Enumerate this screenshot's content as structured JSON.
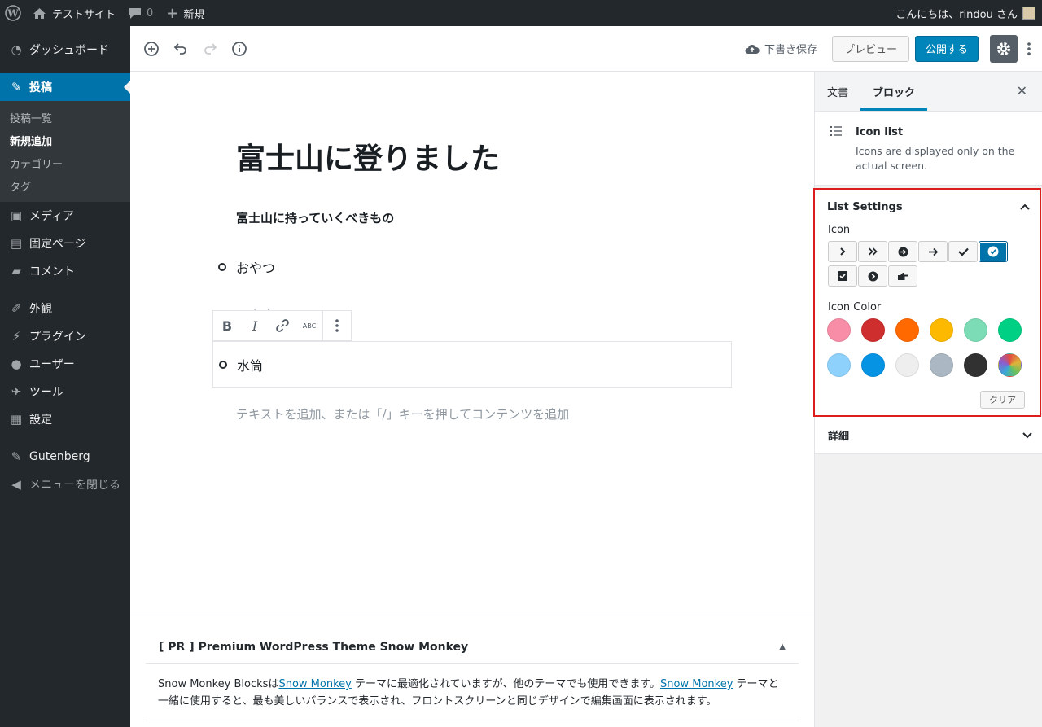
{
  "adminbar": {
    "site_name": "テストサイト",
    "comments_count": "0",
    "new_label": "新規",
    "greeting": "こんにちは、rindou さん"
  },
  "menu": {
    "dashboard": "ダッシュボード",
    "posts": "投稿",
    "posts_sub": [
      "投稿一覧",
      "新規追加",
      "カテゴリー",
      "タグ"
    ],
    "media": "メディア",
    "pages": "固定ページ",
    "comments": "コメント",
    "appearance": "外観",
    "plugins": "プラグイン",
    "users": "ユーザー",
    "tools": "ツール",
    "settings": "設定",
    "gutenberg": "Gutenberg",
    "collapse": "メニューを閉じる"
  },
  "header": {
    "save_draft": "下書き保存",
    "preview": "プレビュー",
    "publish": "公開する"
  },
  "post": {
    "title": "富士山に登りました",
    "subheading": "富士山に持っていくべきもの",
    "list_items": [
      "おやつ",
      "水筒"
    ],
    "hidden_item": "お弁当",
    "placeholder": "テキストを追加、または「/」キーを押してコンテンツを追加"
  },
  "block_toolbar": {
    "bold": "B",
    "italic": "I",
    "strike": "ABC"
  },
  "sidebar": {
    "tab_document": "文書",
    "tab_block": "ブロック",
    "block_name": "Icon list",
    "block_desc": "Icons are displayed only on the actual screen.",
    "list_settings": "List Settings",
    "icon_label": "Icon",
    "icons": [
      "chevron-right",
      "double-chevron-right",
      "circle-arrow-right",
      "arrow-right",
      "check",
      "check-circle",
      "check-square",
      "circle-chevron-right",
      "hand-point-right"
    ],
    "selected_icon_index": 5,
    "icon_color_label": "Icon Color",
    "colors": [
      "#f78da7",
      "#cf2e2e",
      "#ff6900",
      "#fcb900",
      "#7bdcb5",
      "#00d084",
      "#8ed1fc",
      "#0693e3",
      "#eeeeee",
      "#abb8c3",
      "#313131",
      "gradient"
    ],
    "clear": "クリア",
    "details": "詳細"
  },
  "metabox": {
    "title": "[ PR ] Premium WordPress Theme Snow Monkey",
    "text_1": "Snow Monkey Blocksは",
    "link": "Snow Monkey",
    "text_2": "テーマに最適化されていますが、他のテーマでも使用できます。",
    "text_3": "テーマと一緒に使用すると、最も美しいバランスで表示され、フロントスクリーンと同じデザインで編集画面に表示されます。"
  }
}
